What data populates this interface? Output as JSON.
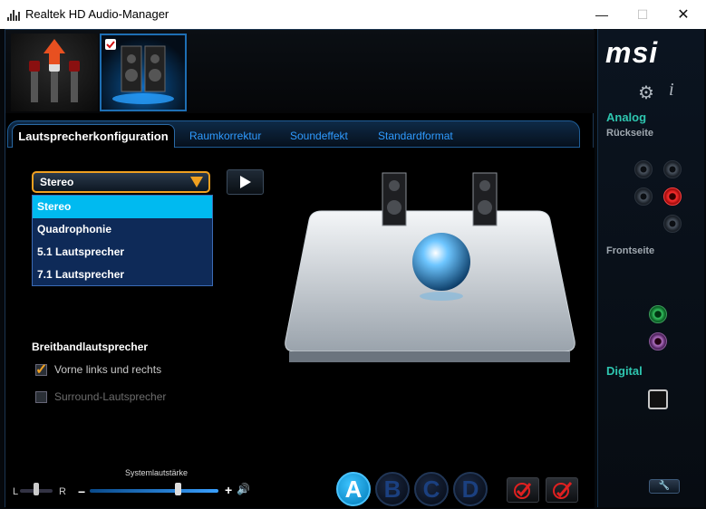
{
  "window": {
    "title": "Realtek HD Audio-Manager",
    "minimize_glyph": "—",
    "maximize_glyph": "☐",
    "close_glyph": "✕"
  },
  "tabs": {
    "active": "Lautsprecherkonfiguration",
    "others": [
      "Raumkorrektur",
      "Soundeffekt",
      "Standardformat"
    ]
  },
  "speaker_config": {
    "selected": "Stereo",
    "options": [
      "Stereo",
      "Quadrophonie",
      "5.1 Lautsprecher",
      "7.1 Lautsprecher"
    ]
  },
  "broadband": {
    "title": "Breitbandlautsprecher",
    "front": {
      "label": "Vorne links und rechts",
      "checked": true,
      "enabled": true
    },
    "surround": {
      "label": "Surround-Lautsprecher",
      "checked": false,
      "enabled": false
    }
  },
  "volume": {
    "label": "Systemlautstärke",
    "balance_left": "L",
    "balance_right": "R",
    "minus": "−",
    "plus": "+",
    "level_fraction": 0.72,
    "balance_fraction": 0.5
  },
  "profiles": [
    "A",
    "B",
    "C",
    "D"
  ],
  "active_profile": "A",
  "right_panel": {
    "brand": "msi",
    "analog": "Analog",
    "rear": "Rückseite",
    "front": "Frontseite",
    "digital": "Digital"
  },
  "colors": {
    "accent": "#f0a020",
    "tab_link": "#2f9bff",
    "selected_item": "#00baf0",
    "section_heading": "#2ec6b0"
  },
  "icons": [
    "settings-gear-icon",
    "info-icon",
    "play-icon",
    "wrench-icon",
    "speaker-icon"
  ]
}
